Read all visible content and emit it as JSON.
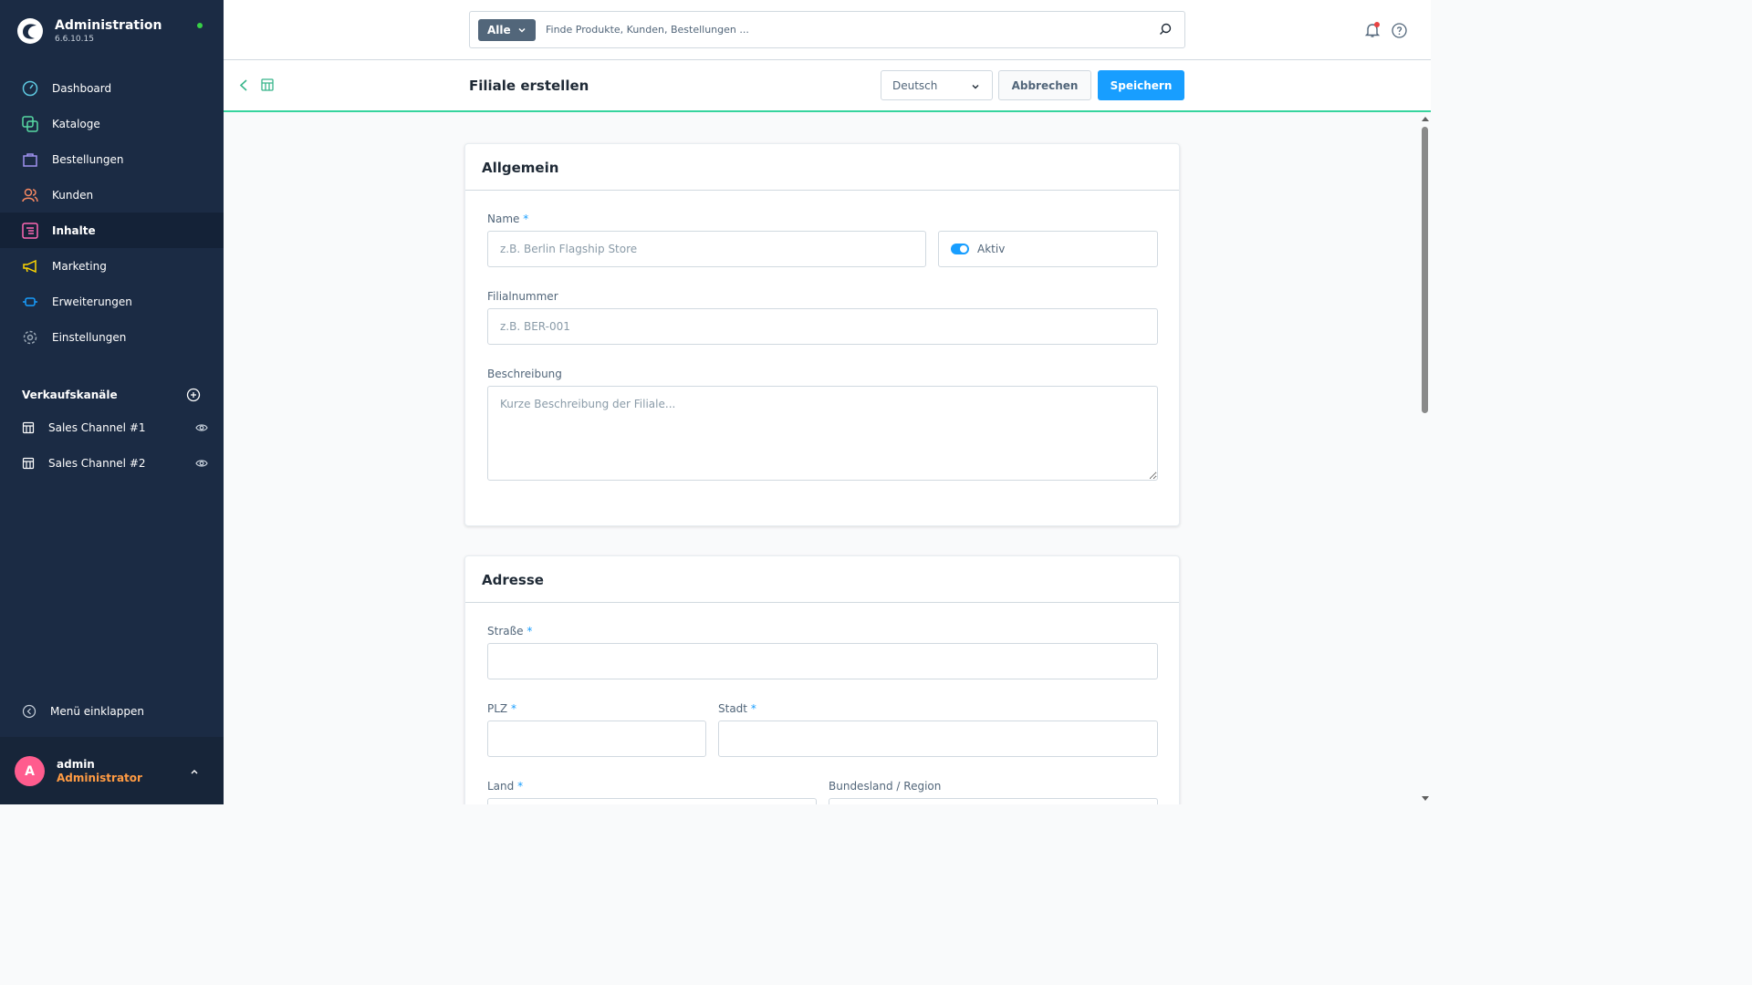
{
  "app": {
    "title": "Administration",
    "version": "6.6.10.15"
  },
  "nav": {
    "items": [
      {
        "label": "Dashboard",
        "icon": "dashboard-icon",
        "color": "#5ec8e0"
      },
      {
        "label": "Kataloge",
        "icon": "catalog-icon",
        "color": "#57d9a3"
      },
      {
        "label": "Bestellungen",
        "icon": "orders-icon",
        "color": "#a092f0"
      },
      {
        "label": "Kunden",
        "icon": "customers-icon",
        "color": "#f88962"
      },
      {
        "label": "Inhalte",
        "icon": "content-icon",
        "color": "#ff68b4",
        "active": true
      },
      {
        "label": "Marketing",
        "icon": "marketing-icon",
        "color": "#ffd700"
      },
      {
        "label": "Erweiterungen",
        "icon": "extensions-icon",
        "color": "#189eff"
      },
      {
        "label": "Einstellungen",
        "icon": "settings-icon",
        "color": "#9aa8b5"
      }
    ]
  },
  "sales_channels": {
    "heading": "Verkaufskanäle",
    "items": [
      {
        "label": "Sales Channel #1"
      },
      {
        "label": "Sales Channel #2"
      }
    ]
  },
  "collapse_label": "Menü einklappen",
  "user": {
    "initial": "A",
    "name": "admin",
    "role": "Administrator"
  },
  "search": {
    "type": "Alle",
    "placeholder": "Finde Produkte, Kunden, Bestellungen ..."
  },
  "page": {
    "title": "Filiale erstellen",
    "language": "Deutsch",
    "cancel_label": "Abbrechen",
    "save_label": "Speichern"
  },
  "general": {
    "title": "Allgemein",
    "name_label": "Name",
    "name_placeholder": "z.B. Berlin Flagship Store",
    "active_label": "Aktiv",
    "active": true,
    "number_label": "Filialnummer",
    "number_placeholder": "z.B. BER-001",
    "description_label": "Beschreibung",
    "description_placeholder": "Kurze Beschreibung der Filiale..."
  },
  "address": {
    "title": "Adresse",
    "street_label": "Straße",
    "zip_label": "PLZ",
    "city_label": "Stadt",
    "country_label": "Land",
    "state_label": "Bundesland / Region"
  },
  "required_marker": "*",
  "colors": {
    "sidebar": "#1b2b44",
    "accent": "#189eff",
    "header_border": "#37d49e",
    "avatar": "#ff5c8e",
    "role": "#ff9b43"
  }
}
